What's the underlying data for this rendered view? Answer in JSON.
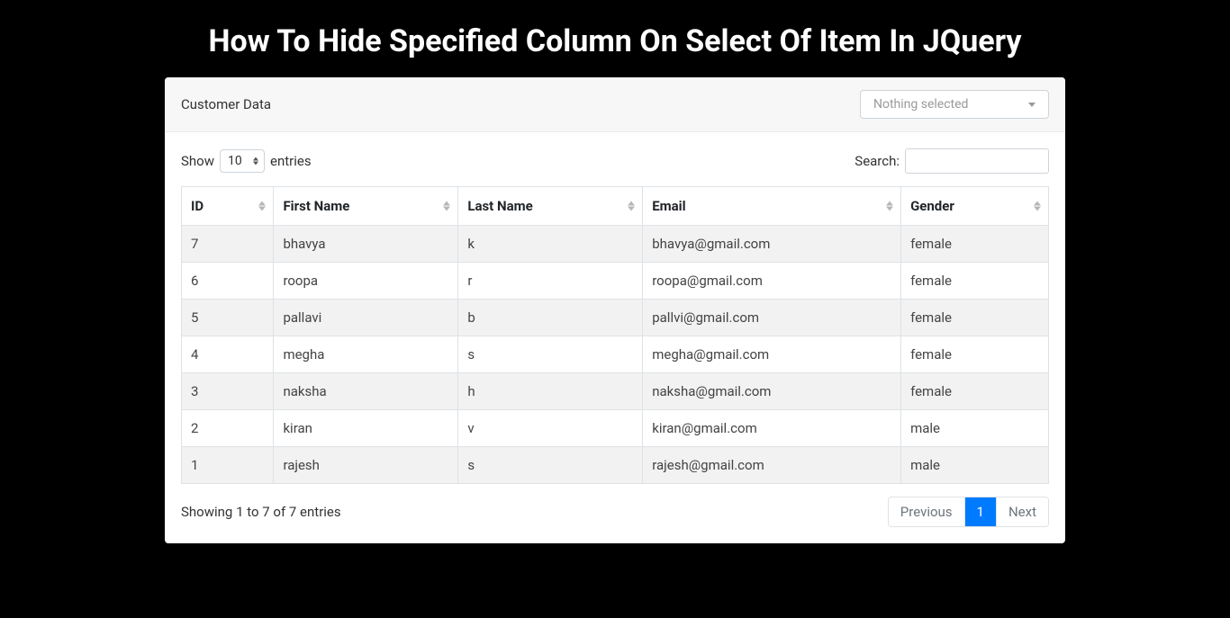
{
  "title": "How To Hide Specified Column On Select Of Item In JQuery",
  "card": {
    "header_title": "Customer Data",
    "dropdown_placeholder": "Nothing selected"
  },
  "controls": {
    "show_label": "Show",
    "entries_label": "entries",
    "length_value": "10",
    "search_label": "Search:"
  },
  "table": {
    "columns": [
      "ID",
      "First Name",
      "Last Name",
      "Email",
      "Gender"
    ],
    "rows": [
      {
        "id": "7",
        "first": "bhavya",
        "last": "k",
        "email": "bhavya@gmail.com",
        "gender": "female"
      },
      {
        "id": "6",
        "first": "roopa",
        "last": "r",
        "email": "roopa@gmail.com",
        "gender": "female"
      },
      {
        "id": "5",
        "first": "pallavi",
        "last": "b",
        "email": "pallvi@gmail.com",
        "gender": "female"
      },
      {
        "id": "4",
        "first": "megha",
        "last": "s",
        "email": "megha@gmail.com",
        "gender": "female"
      },
      {
        "id": "3",
        "first": "naksha",
        "last": "h",
        "email": "naksha@gmail.com",
        "gender": "female"
      },
      {
        "id": "2",
        "first": "kiran",
        "last": "v",
        "email": "kiran@gmail.com",
        "gender": "male"
      },
      {
        "id": "1",
        "first": "rajesh",
        "last": "s",
        "email": "rajesh@gmail.com",
        "gender": "male"
      }
    ]
  },
  "footer": {
    "info": "Showing 1 to 7 of 7 entries",
    "previous": "Previous",
    "page1": "1",
    "next": "Next"
  }
}
